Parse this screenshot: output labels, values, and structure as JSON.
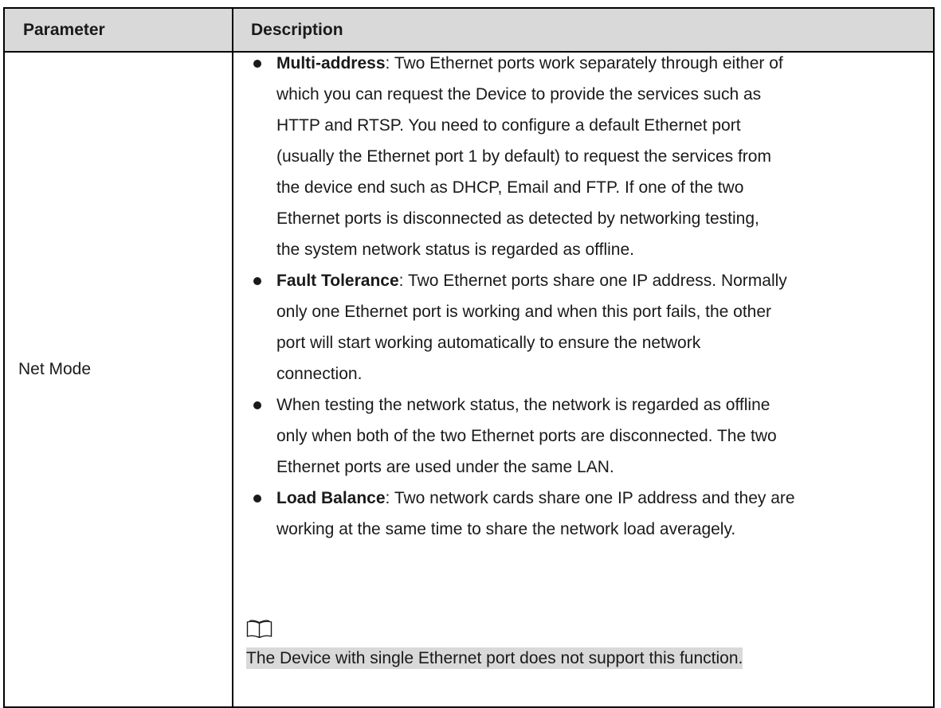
{
  "table": {
    "header": {
      "parameter": "Parameter",
      "description": "Description"
    },
    "row": {
      "parameter": "Net Mode",
      "bullets": [
        {
          "bold": "Multi-address",
          "lines": [
            ": Two Ethernet ports work separately through either of",
            "which you can request the Device to provide the services such as",
            "HTTP and RTSP. You need to configure a default Ethernet port",
            "(usually the Ethernet port 1 by default) to request the services from",
            "the device end such as DHCP, Email and FTP. If one of the two",
            "Ethernet ports is disconnected as detected by networking testing,",
            "the system network status is regarded as offline."
          ]
        },
        {
          "bold": "Fault Tolerance",
          "lines": [
            ": Two Ethernet ports share one IP address. Normally",
            "only one Ethernet port is working and when this port fails, the other",
            "port will start working automatically to ensure the network",
            "connection."
          ]
        },
        {
          "bold": "",
          "lines": [
            "When testing the network status, the network is regarded as offline",
            "only when both of the two Ethernet ports are disconnected. The two",
            "Ethernet ports are used under the same LAN."
          ]
        },
        {
          "bold": "Load Balance",
          "lines": [
            ": Two network cards share one IP address and they are",
            "working at the same time to share the network load averagely."
          ]
        }
      ],
      "note": {
        "icon": "book-icon",
        "text": "The Device with single Ethernet port does not support this function."
      }
    }
  }
}
